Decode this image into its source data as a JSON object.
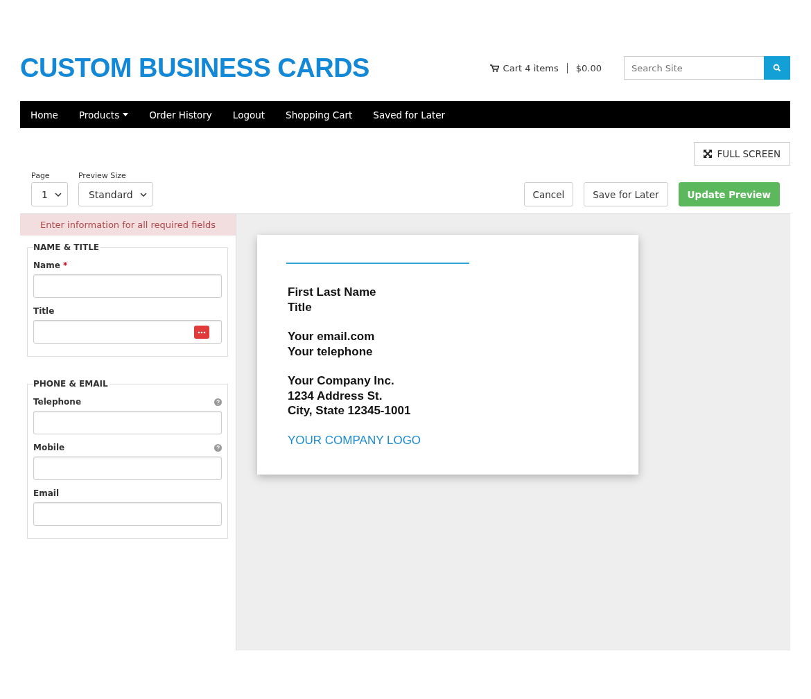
{
  "header": {
    "title": "CUSTOM BUSINESS CARDS",
    "cart": "Cart 4 items",
    "total": "$0.00",
    "search": {
      "placeholder": "Search Site"
    }
  },
  "nav": [
    {
      "label": "Home",
      "dropdown": false
    },
    {
      "label": "Products",
      "dropdown": true
    },
    {
      "label": "Order History",
      "dropdown": false
    },
    {
      "label": "Logout",
      "dropdown": false
    },
    {
      "label": "Shopping Cart",
      "dropdown": false
    },
    {
      "label": "Saved for Later",
      "dropdown": false
    }
  ],
  "fullscreen": "FULL SCREEN",
  "selects": [
    {
      "label": "Page",
      "value": "1"
    },
    {
      "label": "Preview Size",
      "value": "Standard"
    }
  ],
  "actions": [
    {
      "label": "Cancel",
      "primary": false
    },
    {
      "label": "Save for Later",
      "primary": false
    },
    {
      "label": "Update Preview",
      "primary": true
    }
  ],
  "alert": "Enter information for all required fields",
  "sections": [
    {
      "legend": "NAME & TITLE",
      "fields": [
        {
          "label": "Name",
          "required_mark": "*",
          "help": false,
          "autofill_badge": false
        },
        {
          "label": "Title",
          "help": false,
          "autofill_badge": true
        }
      ]
    },
    {
      "legend": "PHONE & EMAIL",
      "fields": [
        {
          "label": "Telephone",
          "help": true,
          "autofill_badge": false
        },
        {
          "label": "Mobile",
          "help": true,
          "autofill_badge": false
        },
        {
          "label": "Email",
          "help": false,
          "autofill_badge": false
        }
      ]
    }
  ],
  "card": {
    "blocks": [
      {
        "kind": "text",
        "lines": [
          "First Last Name",
          "Title"
        ]
      },
      {
        "kind": "text",
        "lines": [
          "Your email.com",
          "Your telephone"
        ]
      },
      {
        "kind": "text",
        "lines": [
          "Your Company Inc.",
          "1234 Address St.",
          "City, State 12345-1001"
        ]
      },
      {
        "kind": "logo",
        "lines": [
          "YOUR COMPANY LOGO"
        ]
      }
    ]
  }
}
